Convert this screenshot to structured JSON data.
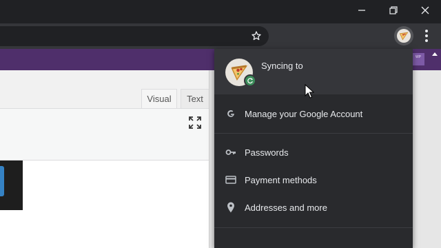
{
  "profile_menu": {
    "sync_status": "Syncing to",
    "items": [
      {
        "icon": "google-g-icon",
        "label": "Manage your Google Account"
      },
      {
        "icon": "key-icon",
        "label": "Passwords"
      },
      {
        "icon": "credit-card-icon",
        "label": "Payment methods"
      },
      {
        "icon": "location-pin-icon",
        "label": "Addresses and more"
      }
    ]
  },
  "editor": {
    "tabs": [
      "Visual",
      "Text"
    ],
    "active_tab": "Visual"
  },
  "wp_badge": "WP",
  "colors": {
    "menu_bg": "#292a2d",
    "menu_header_bg": "#35363a",
    "sync_badge": "#3c8d5a",
    "admin_bar": "#4f2f6b",
    "window_bg": "#202124"
  }
}
